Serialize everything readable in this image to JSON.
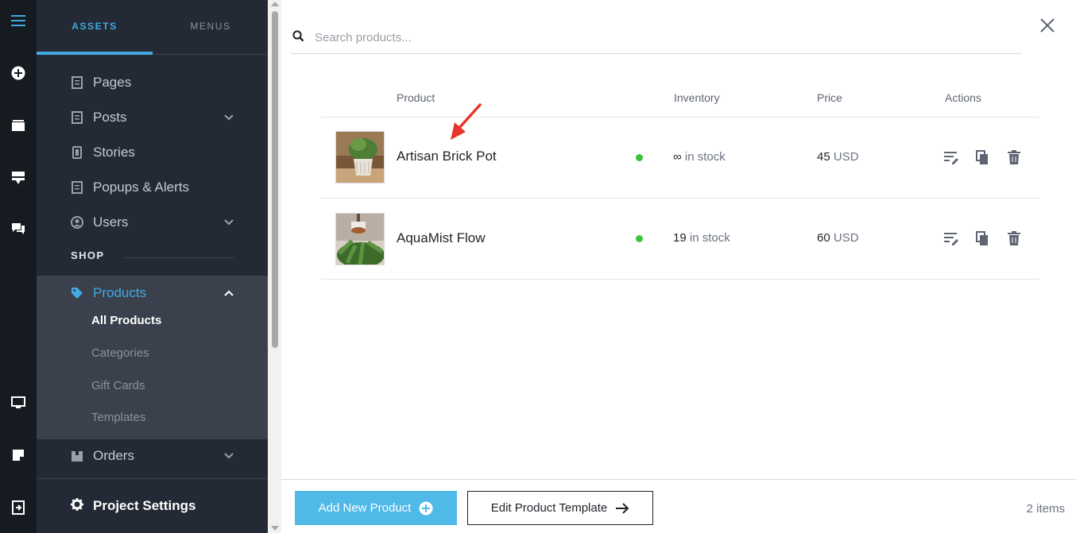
{
  "rail": {
    "icons": [
      "menu-icon",
      "add-circle-icon",
      "layers-icon",
      "sections-icon",
      "comments-icon",
      "desktop-icon",
      "note-icon",
      "exit-icon"
    ],
    "accent": "#43a9e0"
  },
  "sidebar": {
    "tabs": [
      {
        "label": "ASSETS"
      },
      {
        "label": "MENUS"
      }
    ],
    "items": [
      {
        "label": "Pages"
      },
      {
        "label": "Posts"
      },
      {
        "label": "Stories"
      },
      {
        "label": "Popups & Alerts"
      },
      {
        "label": "Users"
      }
    ],
    "section_label": "SHOP",
    "products": {
      "label": "Products",
      "color": "#43a9e0",
      "sub_items": [
        {
          "label": "All Products"
        },
        {
          "label": "Categories"
        },
        {
          "label": "Gift Cards"
        },
        {
          "label": "Templates"
        }
      ]
    },
    "orders": {
      "label": "Orders"
    },
    "settings": {
      "label": "Project Settings"
    }
  },
  "search": {
    "placeholder": "Search products..."
  },
  "table": {
    "headers": [
      "Product",
      "Inventory",
      "Price",
      "Actions"
    ],
    "rows": [
      {
        "name": "Artisan Brick Pot",
        "status_color": "#3cc23c",
        "inventory_value": "∞",
        "inventory_unit": "in stock",
        "price_value": "45",
        "price_currency": "USD"
      },
      {
        "name": "AquaMist Flow",
        "status_color": "#3cc23c",
        "inventory_value": "19",
        "inventory_unit": "in stock",
        "price_value": "60",
        "price_currency": "USD"
      }
    ]
  },
  "footer": {
    "add_label": "Add New Product",
    "template_label": "Edit Product Template",
    "count": "2 items",
    "add_color": "#4fb9e8"
  }
}
